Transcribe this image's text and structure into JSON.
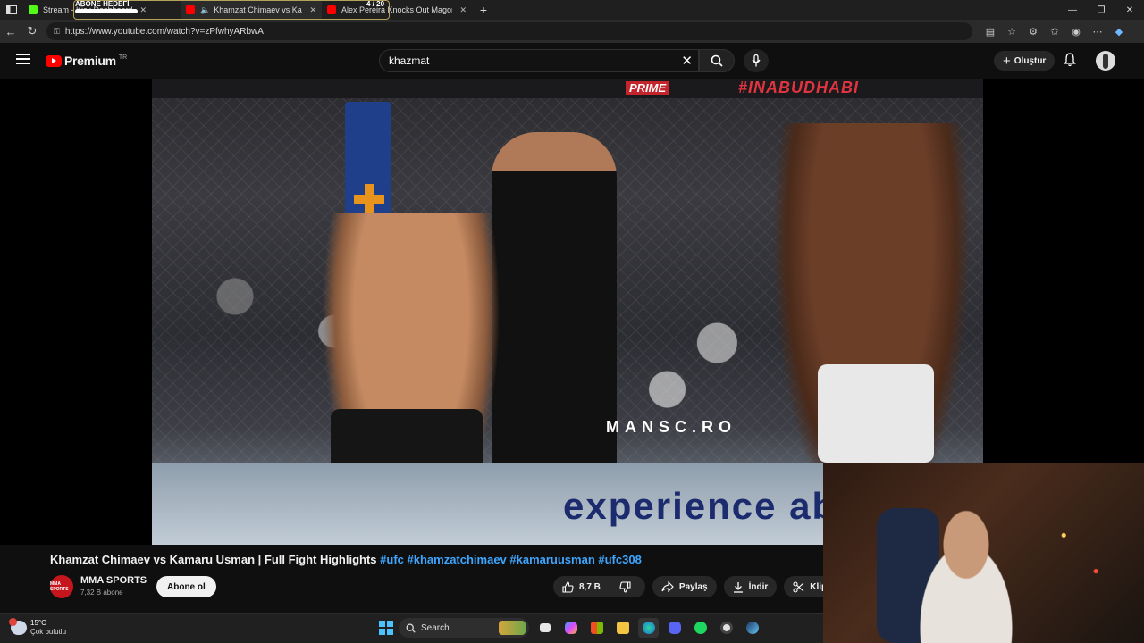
{
  "browser": {
    "tabs": [
      {
        "title": "Stream - Kick Dashboard",
        "favicon_color": "#53fc18"
      },
      {
        "title": "Khamzat Chimaev vs Kamaru",
        "favicon_color": "#ff0000",
        "active": true
      },
      {
        "title": "Alex Pereira Knocks Out Magome",
        "favicon_color": "#ff0000"
      }
    ],
    "new_tab_glyph": "+",
    "url": "https://www.youtube.com/watch?v=zPfwhyARbwA"
  },
  "stream_overlay": {
    "goal_label": "ABONE HEDEFİ",
    "goal_count": "4 / 20",
    "goal_progress": 0.2
  },
  "youtube": {
    "logo_text": "Premium",
    "region": "TR",
    "search_value": "khazmat",
    "create_label": "Oluştur"
  },
  "video": {
    "banner_brand": "PRIME",
    "banner_hashtag": "#INABUDHABI",
    "mat_text": "MANSC.RO",
    "mat_brand": "experience abu",
    "title_main": "Khamzat Chimaev vs Kamaru Usman | Full Fight Highlights ",
    "title_tags": "#ufc #khamzatchimaev #kamaruusman #ufc308",
    "channel": {
      "name": "MMA SPORTS",
      "subscribers": "7,32 B abone",
      "avatar_text": "MMA SPORTS"
    },
    "subscribe_label": "Abone ol",
    "actions": {
      "likes": "8,7 B",
      "share": "Paylaş",
      "download": "İndir",
      "clip": "Klip",
      "more": "..."
    }
  },
  "taskbar": {
    "temperature": "15°C",
    "condition": "Çok bulutlu",
    "search_placeholder": "Search",
    "apps": [
      "task-view",
      "copilot",
      "store",
      "file-explorer",
      "edge",
      "discord",
      "spotify",
      "obs",
      "steam"
    ]
  },
  "colors": {
    "yt_red": "#ff0000",
    "link_blue": "#3ea6ff",
    "kick_green": "#53fc18"
  }
}
